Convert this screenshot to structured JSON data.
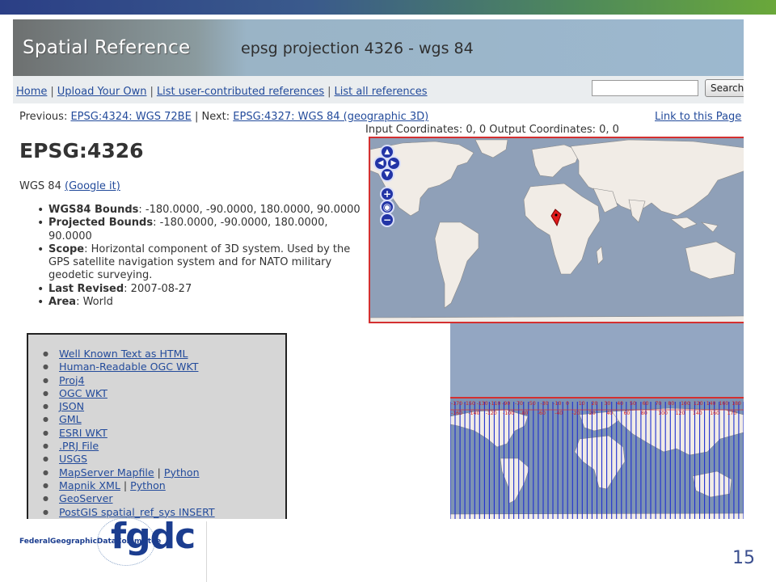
{
  "banner": {
    "logo_text": "Spatial Reference",
    "title": "epsg projection 4326 - wgs 84"
  },
  "nav": {
    "links": [
      "Home",
      "Upload Your Own",
      "List user-contributed references",
      "List all references"
    ],
    "separator": "|",
    "search_value": "",
    "search_button": "Search"
  },
  "prevnext": {
    "previous_label": "Previous:",
    "previous_link": "EPSG:4324: WGS 72BE",
    "next_label": "| Next:",
    "next_link": "EPSG:4327: WGS 84 (geographic 3D)",
    "link_page": "Link to this Page"
  },
  "coords_text": "Input Coordinates: 0, 0 Output Coordinates: 0, 0",
  "epsg": {
    "code": "EPSG:4326",
    "name": "WGS 84",
    "google_link": "(Google it)"
  },
  "properties": [
    {
      "label": "WGS84 Bounds",
      "value": ": -180.0000, -90.0000, 180.0000, 90.0000"
    },
    {
      "label": "Projected Bounds",
      "value": ": -180.0000, -90.0000, 180.0000, 90.0000"
    },
    {
      "label": "Scope",
      "value": ": Horizontal component of 3D system. Used by the GPS satellite navigation system and for NATO military geodetic surveying."
    },
    {
      "label": "Last Revised",
      "value": ": 2007-08-27"
    },
    {
      "label": "Area",
      "value": ": World"
    }
  ],
  "formats": [
    [
      "Well Known Text as HTML"
    ],
    [
      "Human-Readable OGC WKT"
    ],
    [
      "Proj4"
    ],
    [
      "OGC WKT"
    ],
    [
      "JSON"
    ],
    [
      "GML"
    ],
    [
      "ESRI WKT"
    ],
    [
      ".PRJ File"
    ],
    [
      "USGS"
    ],
    [
      "MapServer Mapfile",
      "Python"
    ],
    [
      "Mapnik XML",
      "Python"
    ],
    [
      "GeoServer"
    ],
    [
      "PostGIS spatial_ref_sys INSERT"
    ]
  ],
  "map_controls": {
    "zoom_in": "+",
    "zoom_out": "−",
    "globe": "◉"
  },
  "zone_labels_top": [
    "-170",
    "-150",
    "-130",
    "-110",
    "-90",
    "-70",
    "-50",
    "-30",
    "-10",
    "0",
    "10",
    "20",
    "30",
    "40",
    "50",
    "60",
    "70",
    "80",
    "100",
    "120",
    "140",
    "160",
    "180"
  ],
  "zone_labels_bottom": [
    "-160",
    "-140",
    "-120",
    "-100",
    "-80",
    "-60",
    "-40",
    "-20",
    "20",
    "40",
    "60",
    "80",
    "100",
    "120",
    "140",
    "160",
    "170"
  ],
  "logo": {
    "text": "fgdc",
    "subtitle": "FederalGeographicDataCommittee"
  },
  "page_number": "15",
  "colors": {
    "link": "#234b9b",
    "map_ocean": "#8fa0b8",
    "land": "#f1ece6",
    "map_border": "#d43030",
    "zone_lines": "#1f2fd0"
  }
}
